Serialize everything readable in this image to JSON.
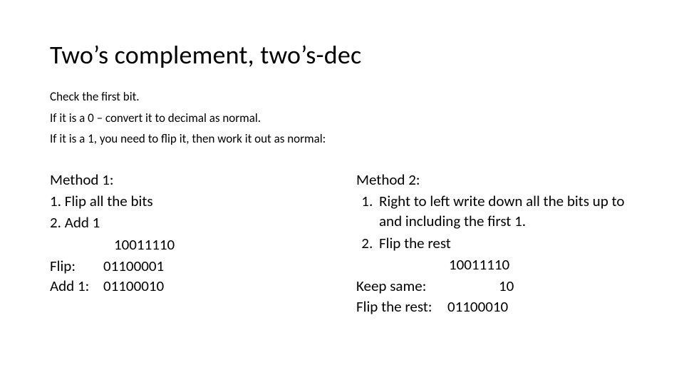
{
  "title": "Two’s complement, two’s-dec",
  "intro": {
    "l1": "Check the first bit.",
    "l2": "If it is a 0 – convert it to decimal as normal.",
    "l3": "If it is a 1, you need to flip it, then work it out as normal:"
  },
  "method1": {
    "heading": "Method 1:",
    "step1": "1. Flip all the bits",
    "step2": "2. Add 1",
    "example": {
      "original": "10011110",
      "flip_label": "Flip:",
      "flip_value": "01100001",
      "add1_label": "Add 1:",
      "add1_value": "01100010"
    }
  },
  "method2": {
    "heading": "Method 2:",
    "step1": "Right to left write down all the bits up to and including the first 1.",
    "step2": "Flip the rest",
    "example": {
      "original": "10011110",
      "keep_label": "Keep same:",
      "keep_value": "10",
      "fliprest_label": "Flip the rest:",
      "fliprest_value": "01100010"
    }
  }
}
